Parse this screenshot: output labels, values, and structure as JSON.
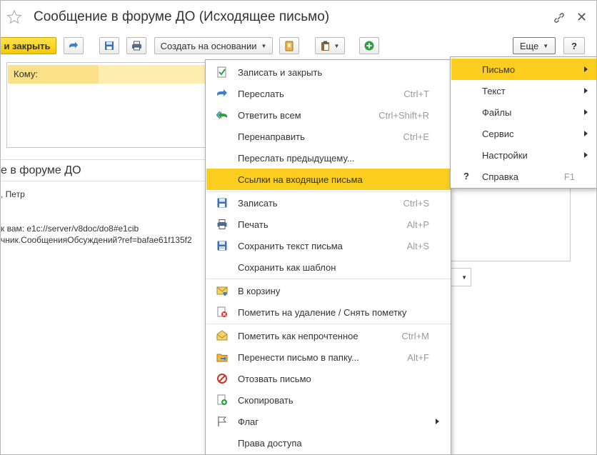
{
  "window": {
    "title": "Сообщение в форуме ДО (Исходящее письмо)"
  },
  "toolbar": {
    "save_close_label": "и закрыть",
    "create_based_label": "Создать на основании",
    "more_label": "Еще",
    "help_label": "?"
  },
  "form": {
    "to_label": "Кому:",
    "subject": "е в форуме ДО",
    "body_lines": [
      ", Петр",
      "к вам: e1c://server/v8doc/do8#e1cib",
      "чник.СообщенияОбсуждений?ref=bafae61f135f2"
    ]
  },
  "menu": {
    "items": [
      {
        "label": "Записать и закрыть",
        "shortcut": "",
        "icon": "check-doc-icon"
      },
      {
        "label": "Переслать",
        "shortcut": "Ctrl+T",
        "icon": "forward-arrow-icon"
      },
      {
        "label": "Ответить всем",
        "shortcut": "Ctrl+Shift+R",
        "icon": "reply-all-icon"
      },
      {
        "label": "Перенаправить",
        "shortcut": "Ctrl+E",
        "icon": ""
      },
      {
        "label": "Переслать предыдущему...",
        "shortcut": "",
        "icon": ""
      },
      {
        "label": "Ссылки на входящие письма",
        "shortcut": "",
        "icon": ""
      },
      {
        "label": "Записать",
        "shortcut": "Ctrl+S",
        "icon": "floppy-icon"
      },
      {
        "label": "Печать",
        "shortcut": "Alt+P",
        "icon": "printer-icon"
      },
      {
        "label": "Сохранить текст письма",
        "shortcut": "Alt+S",
        "icon": "save-text-icon"
      },
      {
        "label": "Сохранить как шаблон",
        "shortcut": "",
        "icon": ""
      },
      {
        "label": "В корзину",
        "shortcut": "",
        "icon": "trash-envelope-icon"
      },
      {
        "label": "Пометить на удаление / Снять пометку",
        "shortcut": "",
        "icon": "mark-delete-icon"
      },
      {
        "label": "Пометить как непрочтенное",
        "shortcut": "Ctrl+M",
        "icon": "envelope-icon"
      },
      {
        "label": "Перенести письмо в папку...",
        "shortcut": "Alt+F",
        "icon": "folder-move-icon"
      },
      {
        "label": "Отозвать письмо",
        "shortcut": "",
        "icon": "no-entry-icon"
      },
      {
        "label": "Скопировать",
        "shortcut": "",
        "icon": "copy-add-icon"
      },
      {
        "label": "Флаг",
        "shortcut": "",
        "icon": "flag-icon"
      },
      {
        "label": "Права доступа",
        "shortcut": "",
        "icon": ""
      }
    ],
    "highlighted_index": 5
  },
  "submenu": {
    "items": [
      {
        "label": "Письмо",
        "shortcut": ""
      },
      {
        "label": "Текст",
        "shortcut": ""
      },
      {
        "label": "Файлы",
        "shortcut": ""
      },
      {
        "label": "Сервис",
        "shortcut": ""
      },
      {
        "label": "Настройки",
        "shortcut": ""
      },
      {
        "label": "Справка",
        "shortcut": "F1"
      }
    ],
    "highlighted_index": 0
  },
  "colors": {
    "accent_yellow": "#fbcd1f",
    "field_label_bg": "#fbe08a"
  }
}
